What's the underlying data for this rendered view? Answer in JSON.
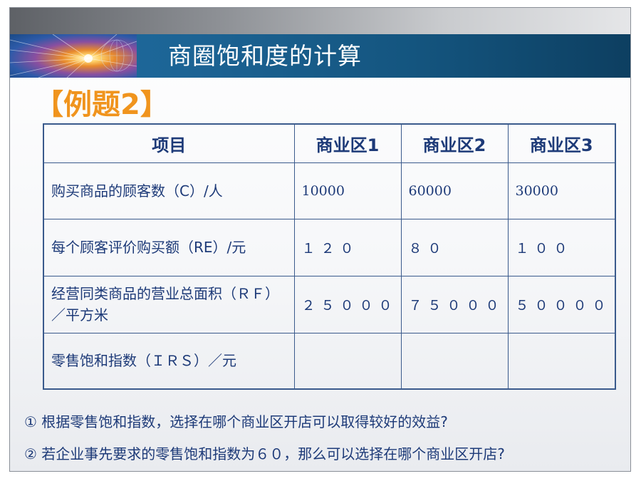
{
  "banner": {
    "title": "商圈饱和度的计算"
  },
  "example_title": "【例题2】",
  "table": {
    "headers": [
      "项目",
      "商业区1",
      "商业区2",
      "商业区3"
    ],
    "rows": [
      {
        "label": "购买商品的顾客数（C）/人",
        "values": [
          "10000",
          "60000",
          "30000"
        ]
      },
      {
        "label": "每个顾客评价购买额（RE）/元",
        "values": [
          "１２０",
          "８０",
          "１００"
        ]
      },
      {
        "label": "经营同类商品的营业总面积（ＲＦ）／平方米",
        "values": [
          "２５０００",
          "７５０００",
          "５００００"
        ]
      },
      {
        "label": "零售饱和指数（ＩＲＳ）／元",
        "values": [
          "",
          "",
          ""
        ]
      }
    ]
  },
  "questions": [
    "① 根据零售饱和指数，选择在哪个商业区开店可以取得较好的效益?",
    "② 若企业事先要求的零售饱和指数为６０，那么可以选择在哪个商业区开店?"
  ],
  "colors": {
    "title_orange": "#f0941d",
    "text_blue": "#1d3a78",
    "banner_blue": "#1c6394"
  }
}
